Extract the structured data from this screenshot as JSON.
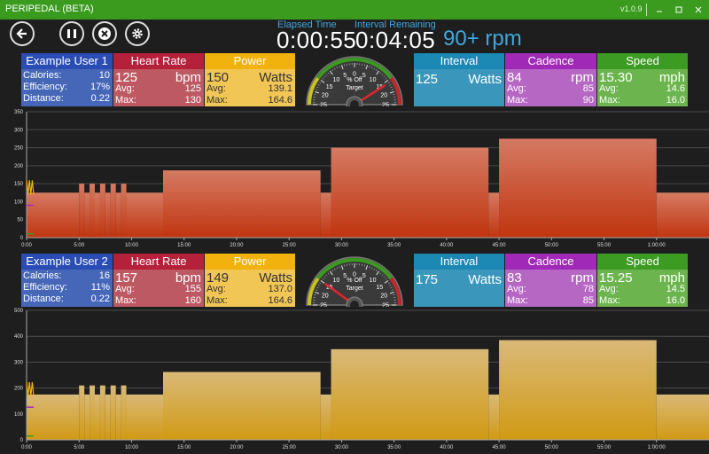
{
  "app": {
    "title": "PERIPEDAL (BETA)",
    "version": "v1.0.9"
  },
  "window": {
    "minimize_icon": "minimize-icon",
    "maximize_icon": "maximize-icon",
    "close_icon": "close-icon"
  },
  "controls": {
    "back_icon": "back-arrow-icon",
    "pause_icon": "pause-icon",
    "stop_icon": "stop-icon",
    "settings_icon": "gear-icon"
  },
  "timers": {
    "elapsed_label": "Elapsed Time",
    "elapsed": "0:00:55",
    "interval_label": "Interval Remaining",
    "interval": "0:04:05",
    "rpm_target": "90+ rpm"
  },
  "colors": {
    "titlebar": "#3a9b1f",
    "user": "#2a4db5",
    "heart": "#b5203a",
    "power": "#f2b20e",
    "interval": "#1b89b3",
    "cadence": "#a129b8",
    "speed": "#3b9b22",
    "user_body": "#4666b8",
    "heart_body": "#bd5962",
    "power_body": "#f2c655",
    "interval_body": "#3a97bb",
    "cadence_body": "#b667c4",
    "speed_body": "#6cb54e"
  },
  "users": [
    {
      "name": "Example User 1",
      "calories_label": "Calories:",
      "calories": "10",
      "efficiency_label": "Efficiency:",
      "efficiency": "17%",
      "distance_label": "Distance:",
      "distance": "0.22",
      "heart": {
        "label": "Heart Rate",
        "value": "125",
        "unit": "bpm",
        "avg_label": "Avg:",
        "avg": "125",
        "max_label": "Max:",
        "max": "130"
      },
      "power": {
        "label": "Power",
        "value": "150",
        "unit": "Watts",
        "avg_label": "Avg:",
        "avg": "139.1",
        "max_label": "Max:",
        "max": "164.6"
      },
      "gauge": {
        "label": "% Off",
        "target": "Target",
        "ticks": [
          "25",
          "20",
          "15",
          "10",
          "5",
          "0",
          "5",
          "10",
          "15",
          "20",
          "25"
        ],
        "value_percent": "16"
      },
      "interval": {
        "label": "Interval",
        "value": "125",
        "unit": "Watts"
      },
      "cadence": {
        "label": "Cadence",
        "value": "84",
        "unit": "rpm",
        "avg_label": "Avg:",
        "avg": "85",
        "max_label": "Max:",
        "max": "90"
      },
      "speed": {
        "label": "Speed",
        "value": "15.30",
        "unit": "mph",
        "avg_label": "Avg:",
        "avg": "14.6",
        "max_label": "Max:",
        "max": "16.0"
      }
    },
    {
      "name": "Example User 2",
      "calories_label": "Calories:",
      "calories": "16",
      "efficiency_label": "Efficiency:",
      "efficiency": "11%",
      "distance_label": "Distance:",
      "distance": "0.22",
      "heart": {
        "label": "Heart Rate",
        "value": "157",
        "unit": "bpm",
        "avg_label": "Avg:",
        "avg": "155",
        "max_label": "Max:",
        "max": "160"
      },
      "power": {
        "label": "Power",
        "value": "149",
        "unit": "Watts",
        "avg_label": "Avg:",
        "avg": "137.0",
        "max_label": "Max:",
        "max": "164.6"
      },
      "gauge": {
        "label": "% Off",
        "target": "Target",
        "ticks": [
          "25",
          "20",
          "15",
          "10",
          "5",
          "0",
          "5",
          "10",
          "15",
          "20",
          "25"
        ],
        "value_percent": "-15"
      },
      "interval": {
        "label": "Interval",
        "value": "175",
        "unit": "Watts"
      },
      "cadence": {
        "label": "Cadence",
        "value": "83",
        "unit": "rpm",
        "avg_label": "Avg:",
        "avg": "78",
        "max_label": "Max:",
        "max": "85"
      },
      "speed": {
        "label": "Speed",
        "value": "15.25",
        "unit": "mph",
        "avg_label": "Avg:",
        "avg": "14.5",
        "max_label": "Max:",
        "max": "16.0"
      }
    }
  ],
  "chart_data": [
    {
      "type": "area",
      "x_ticks": [
        "0:00",
        "5:00",
        "10:00",
        "15:00",
        "20:00",
        "25:00",
        "30:00",
        "35:00",
        "40:00",
        "45:00",
        "50:00",
        "55:00",
        "1:00:00"
      ],
      "y_ticks": [
        "0",
        "50",
        "100",
        "150",
        "200",
        "250",
        "300",
        "350"
      ],
      "ylim": [
        0,
        350
      ],
      "xlim_minutes": [
        0,
        65
      ],
      "fill": "#c0350f",
      "fill_top": "#d57a63",
      "steps": [
        {
          "from": 0,
          "to": 5,
          "value": 125
        },
        {
          "from": 5,
          "to": 5.5,
          "value": 150
        },
        {
          "from": 5.5,
          "to": 6,
          "value": 125
        },
        {
          "from": 6,
          "to": 6.5,
          "value": 150
        },
        {
          "from": 6.5,
          "to": 7,
          "value": 125
        },
        {
          "from": 7,
          "to": 7.5,
          "value": 150
        },
        {
          "from": 7.5,
          "to": 8,
          "value": 125
        },
        {
          "from": 8,
          "to": 8.5,
          "value": 150
        },
        {
          "from": 8.5,
          "to": 9,
          "value": 125
        },
        {
          "from": 9,
          "to": 9.5,
          "value": 150
        },
        {
          "from": 9.5,
          "to": 13,
          "value": 125
        },
        {
          "from": 13,
          "to": 28,
          "value": 187
        },
        {
          "from": 28,
          "to": 29,
          "value": 125
        },
        {
          "from": 29,
          "to": 44,
          "value": 250
        },
        {
          "from": 44,
          "to": 45,
          "value": 125
        },
        {
          "from": 45,
          "to": 60,
          "value": 275
        },
        {
          "from": 60,
          "to": 65,
          "value": 125
        }
      ]
    },
    {
      "type": "area",
      "x_ticks": [
        "0:00",
        "5:00",
        "10:00",
        "15:00",
        "20:00",
        "25:00",
        "30:00",
        "35:00",
        "40:00",
        "45:00",
        "50:00",
        "55:00",
        "1:00:00"
      ],
      "y_ticks": [
        "0",
        "100",
        "200",
        "300",
        "400",
        "500"
      ],
      "ylim": [
        0,
        500
      ],
      "xlim_minutes": [
        0,
        65
      ],
      "fill": "#d19a14",
      "fill_top": "#d9b978",
      "steps": [
        {
          "from": 0,
          "to": 5,
          "value": 175
        },
        {
          "from": 5,
          "to": 5.5,
          "value": 210
        },
        {
          "from": 5.5,
          "to": 6,
          "value": 175
        },
        {
          "from": 6,
          "to": 6.5,
          "value": 210
        },
        {
          "from": 6.5,
          "to": 7,
          "value": 175
        },
        {
          "from": 7,
          "to": 7.5,
          "value": 210
        },
        {
          "from": 7.5,
          "to": 8,
          "value": 175
        },
        {
          "from": 8,
          "to": 8.5,
          "value": 210
        },
        {
          "from": 8.5,
          "to": 9,
          "value": 175
        },
        {
          "from": 9,
          "to": 9.5,
          "value": 210
        },
        {
          "from": 9.5,
          "to": 13,
          "value": 175
        },
        {
          "from": 13,
          "to": 28,
          "value": 262
        },
        {
          "from": 28,
          "to": 29,
          "value": 175
        },
        {
          "from": 29,
          "to": 44,
          "value": 350
        },
        {
          "from": 44,
          "to": 45,
          "value": 175
        },
        {
          "from": 45,
          "to": 60,
          "value": 385
        },
        {
          "from": 60,
          "to": 65,
          "value": 175
        }
      ]
    }
  ]
}
